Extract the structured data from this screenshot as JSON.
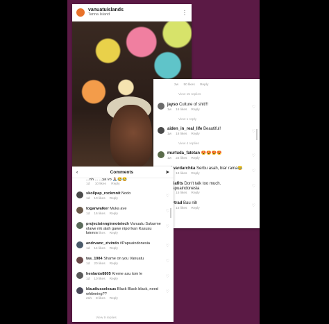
{
  "post": {
    "username": "vanuatuislands",
    "location": "Tanna Island",
    "more_icon": "⋮"
  },
  "right_panel": {
    "top_meta": {
      "time": "2w",
      "likes": "50 likes",
      "reply": "Reply"
    },
    "view_replies_1": "View 15 replies",
    "comments": [
      {
        "user": "jayso",
        "text": "Culture of shit!!!",
        "time": "1w",
        "likes": "16 likes",
        "reply": "Reply",
        "avatar_color": "#6b6b6b"
      },
      {
        "view_replies": "View 1 reply"
      },
      {
        "user": "aiden_in_real_life",
        "text": "Beautiful!",
        "time": "1w",
        "likes": "18 likes",
        "reply": "Reply",
        "avatar_color": "#4a4a4a"
      },
      {
        "view_replies": "View 4 replies"
      },
      {
        "user": "murtuda_fatetan",
        "text": "😍😍😍😍",
        "time": "1w",
        "likes": "22 likes",
        "reply": "Reply",
        "avatar_color": "#5a6b4a"
      },
      {
        "user": "edwardarchka",
        "text": "Serbu asah, biar rama😂",
        "time": "1w",
        "likes": "18 likes",
        "reply": "Reply",
        "avatar_color": "#3e4e6b"
      },
      {
        "user": "yuliafits",
        "text": "Don't talk too much. #Papuaindonesia",
        "time": "1w",
        "likes": "15 likes",
        "reply": "Reply",
        "avatar_color": "#7a5a4a"
      },
      {
        "user": "22ytrad",
        "text": "Bau nih",
        "time": "1w",
        "likes": "15 likes",
        "reply": "Reply",
        "avatar_color": "#555555"
      }
    ]
  },
  "bottom_panel": {
    "header": {
      "back_icon": "‹",
      "title": "Comments",
      "send_icon": "➤"
    },
    "partial_top": {
      "text": "...nh  ... ...ya vo 🙏🏽😂😂",
      "time": "1d",
      "likes": "10 likes",
      "reply": "Reply"
    },
    "comments": [
      {
        "user": "skollpap_rockmnit",
        "text": "Nodo",
        "time": "1d",
        "likes": "10 likes",
        "reply": "Reply",
        "avatar_color": "#4a4a4a"
      },
      {
        "user": "toganwalker",
        "text": "Muka ave",
        "time": "1d",
        "likes": "16 likes",
        "reply": "Reply",
        "avatar_color": "#6a5a4a"
      },
      {
        "user": "projectsinnginnotetech",
        "text": "Vanuatu Sukurme olawe nik alah gawe nipol kan Kasusu kmmm",
        "time": "1d",
        "likes": "16 likes",
        "reply": "Reply",
        "avatar_color": "#5a6a5a"
      },
      {
        "user": "andrvanc_zivindo",
        "text": "#Papuaindonesia",
        "time": "1d",
        "likes": "14 likes",
        "reply": "Reply",
        "avatar_color": "#4a5a6a"
      },
      {
        "user": "tas_1984",
        "text": "Shame on you Vanuatu",
        "time": "1d",
        "likes": "20 likes",
        "reply": "Reply",
        "avatar_color": "#6a4a4a"
      },
      {
        "user": "henlanto8805",
        "text": "Kreme asu tom le",
        "time": "1d",
        "likes": "10 likes",
        "reply": "Reply",
        "avatar_color": "#5a5a5a"
      },
      {
        "user": "klaudiusseleaus",
        "text": "Black Black black, need whitening??",
        "time": "21h",
        "likes": "8 likes",
        "reply": "Reply",
        "avatar_color": "#4a4a5a"
      }
    ],
    "footer_link": "View 9 replies",
    "heart_icon": "♡"
  }
}
